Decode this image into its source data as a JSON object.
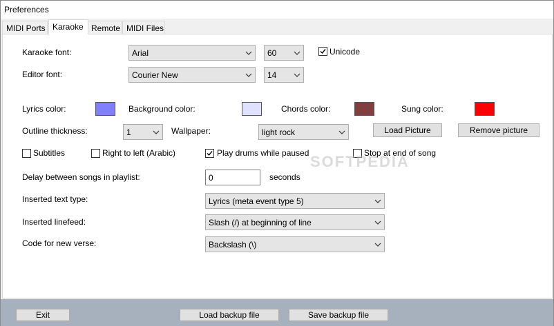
{
  "window": {
    "title": "Preferences"
  },
  "tabs": [
    {
      "label": "MIDI Ports",
      "active": false
    },
    {
      "label": "Karaoke",
      "active": true
    },
    {
      "label": "Remote",
      "active": false
    },
    {
      "label": "MIDI Files",
      "active": false
    }
  ],
  "fonts": {
    "karaoke_label": "Karaoke font:",
    "karaoke_font": "Arial",
    "karaoke_size": "60",
    "unicode_label": "Unicode",
    "unicode_checked": true,
    "editor_label": "Editor font:",
    "editor_font": "Courier New",
    "editor_size": "14"
  },
  "colors": {
    "lyrics_label": "Lyrics color:",
    "lyrics_color": "#8080ff",
    "background_label": "Background color:",
    "background_color": "#e0e0ff",
    "chords_label": "Chords color:",
    "chords_color": "#804040",
    "sung_label": "Sung color:",
    "sung_color": "#ff0000"
  },
  "appearance": {
    "outline_label": "Outline thickness:",
    "outline_value": "1",
    "wallpaper_label": "Wallpaper:",
    "wallpaper_value": "light rock",
    "load_picture_label": "Load Picture",
    "remove_picture_label": "Remove picture"
  },
  "options": {
    "subtitles_label": "Subtitles",
    "subtitles_checked": false,
    "rtl_label": "Right to left (Arabic)",
    "rtl_checked": false,
    "drums_label": "Play drums while paused",
    "drums_checked": true,
    "stop_label": "Stop at end of song",
    "stop_checked": false
  },
  "playlist": {
    "delay_label": "Delay between songs in playlist:",
    "delay_value": "0",
    "delay_unit": "seconds"
  },
  "text": {
    "inserted_type_label": "Inserted text type:",
    "inserted_type_value": "Lyrics (meta event type 5)",
    "linefeed_label": "Inserted linefeed:",
    "linefeed_value": "Slash (/) at beginning of line",
    "verse_label": "Code for new verse:",
    "verse_value": "Backslash (\\)"
  },
  "footer": {
    "exit_label": "Exit",
    "load_backup_label": "Load backup file",
    "save_backup_label": "Save backup file"
  },
  "watermark": "SOFTPEDIA"
}
